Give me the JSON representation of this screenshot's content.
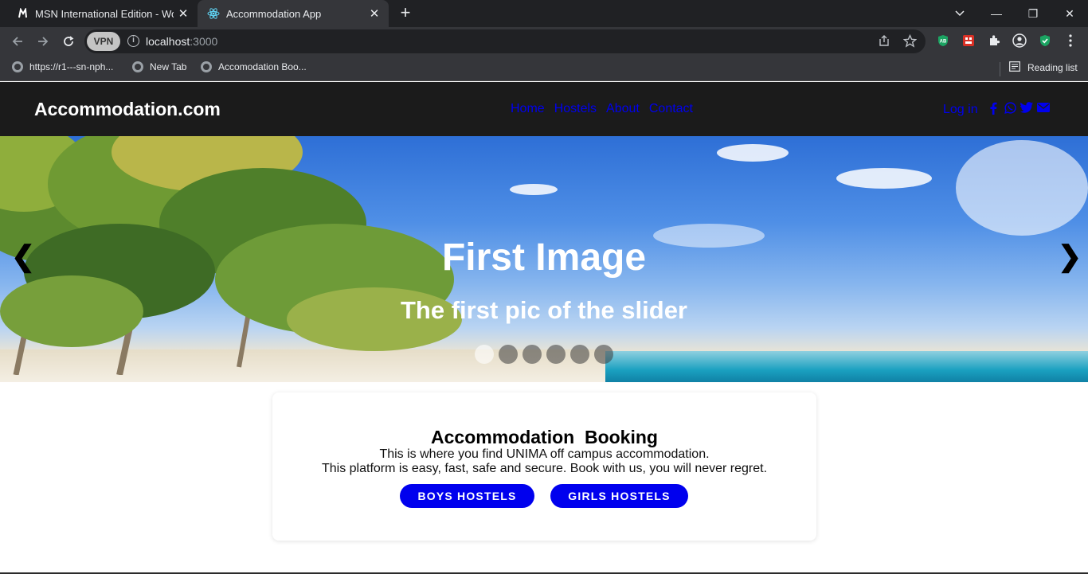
{
  "browser": {
    "tabs": [
      {
        "title": "MSN International Edition - Worl",
        "icon": "msn-icon",
        "close": "✕"
      },
      {
        "title": "Accommodation App",
        "icon": "react-icon",
        "close": "✕"
      }
    ],
    "new_tab": "+",
    "window_controls": {
      "minimize": "—",
      "restore": "❐",
      "close": "✕"
    },
    "vpn_label": "VPN",
    "url_host": "localhost",
    "url_port": ":3000",
    "bookmarks": [
      {
        "label": "https://r1---sn-nph..."
      },
      {
        "label": "New Tab"
      },
      {
        "label": "Accomodation Boo..."
      }
    ],
    "reading_list": "Reading list"
  },
  "site": {
    "brand": "Accommodation.com",
    "nav": [
      "Home",
      "Hostels",
      "About",
      "Contact"
    ],
    "login": "Log in",
    "social_icons": [
      "facebook-icon",
      "whatsapp-icon",
      "twitter-icon",
      "email-icon"
    ],
    "link_color": "#0000ee"
  },
  "slider": {
    "title": "First Image",
    "caption": "The first pic of the slider",
    "prev": "❮",
    "next": "❯",
    "slide_count": 6,
    "active_slide": 1
  },
  "booking": {
    "title": "Accommodation  Booking",
    "line1": "This is where you find UNIMA off campus accommodation.",
    "line2": "This platform is easy, fast, safe and secure. Book with us, you will never regret.",
    "boys_button": "BOYS HOSTELS",
    "girls_button": "GIRLS HOSTELS"
  }
}
